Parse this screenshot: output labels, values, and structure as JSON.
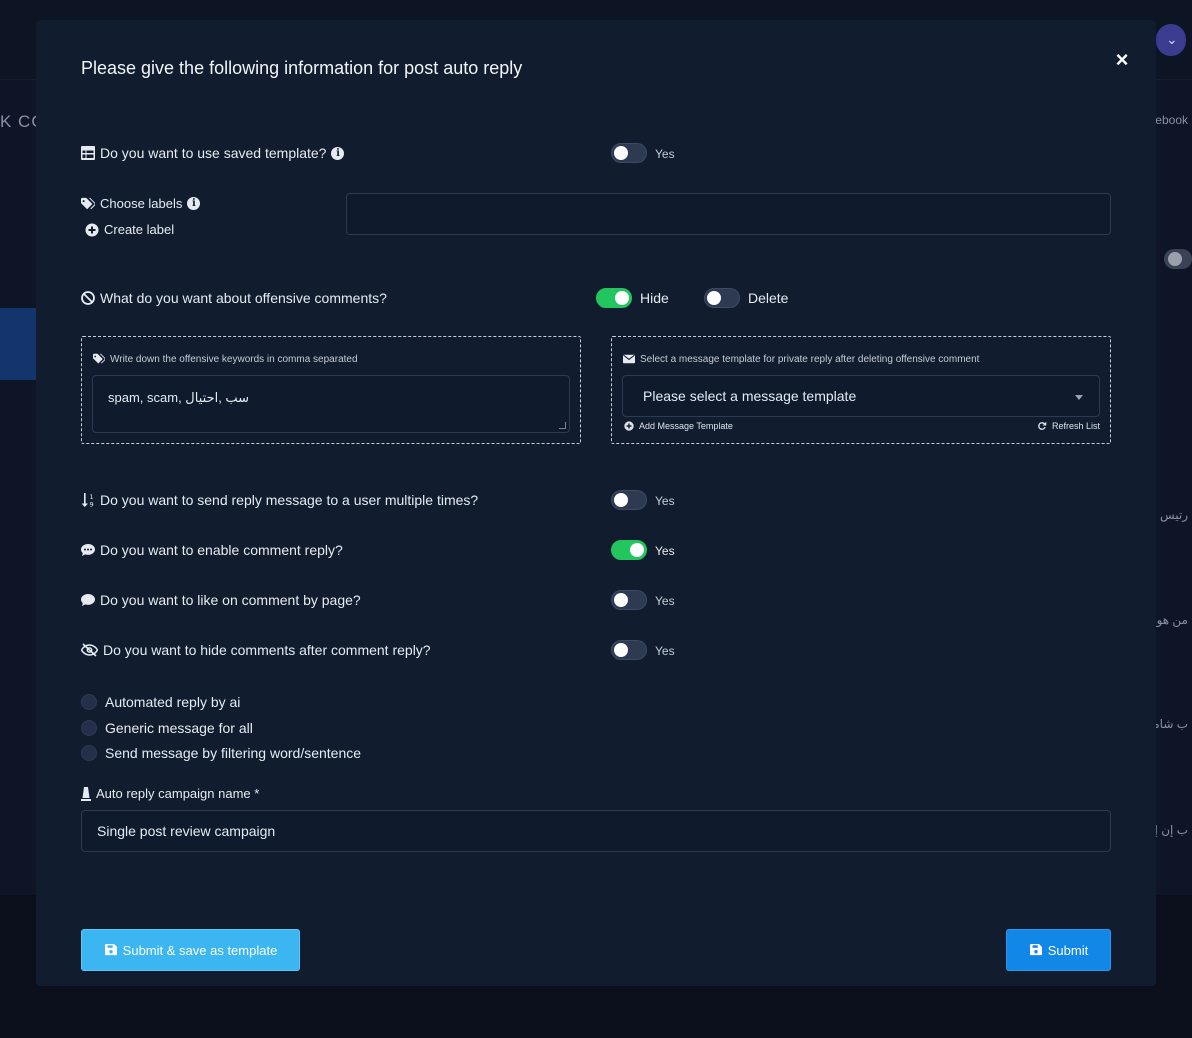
{
  "background": {
    "left_text": "K CO",
    "right_texts": [
      "cebook",
      "رتيس",
      "من هو",
      "ب شامل",
      "ب إن إير"
    ]
  },
  "modal": {
    "title": "Please give the following information for post auto reply",
    "close_label": "×",
    "saved_template": {
      "label": "Do you want to use saved template?",
      "toggle_on": false,
      "toggle_text": "Yes"
    },
    "labels": {
      "label": "Choose labels",
      "create_label": "Create label",
      "input_value": ""
    },
    "offensive": {
      "label": "What do you want about offensive comments?",
      "hide": {
        "text": "Hide",
        "on": true
      },
      "delete": {
        "text": "Delete",
        "on": false
      }
    },
    "keywords_box": {
      "caption": "Write down the offensive keywords in comma separated",
      "value": "spam, scam, سب ,احتيال"
    },
    "template_box": {
      "caption": "Select a message template for private reply after deleting offensive comment",
      "select_value": "Please select a message template",
      "add_template": "Add Message Template",
      "refresh_list": "Refresh List"
    },
    "options": [
      {
        "label": "Do you want to send reply message to a user multiple times?",
        "on": false,
        "toggle_text": "Yes"
      },
      {
        "label": "Do you want to enable comment reply?",
        "on": true,
        "toggle_text": "Yes"
      },
      {
        "label": "Do you want to like on comment by page?",
        "on": false,
        "toggle_text": "Yes"
      },
      {
        "label": "Do you want to hide comments after comment reply?",
        "on": false,
        "toggle_text": "Yes"
      }
    ],
    "radios": [
      "Automated reply by ai",
      "Generic message for all",
      "Send message by filtering word/sentence"
    ],
    "campaign": {
      "label": "Auto reply campaign name *",
      "value": "Single post review campaign"
    },
    "buttons": {
      "save_template": "Submit & save as template",
      "submit": "Submit"
    }
  }
}
